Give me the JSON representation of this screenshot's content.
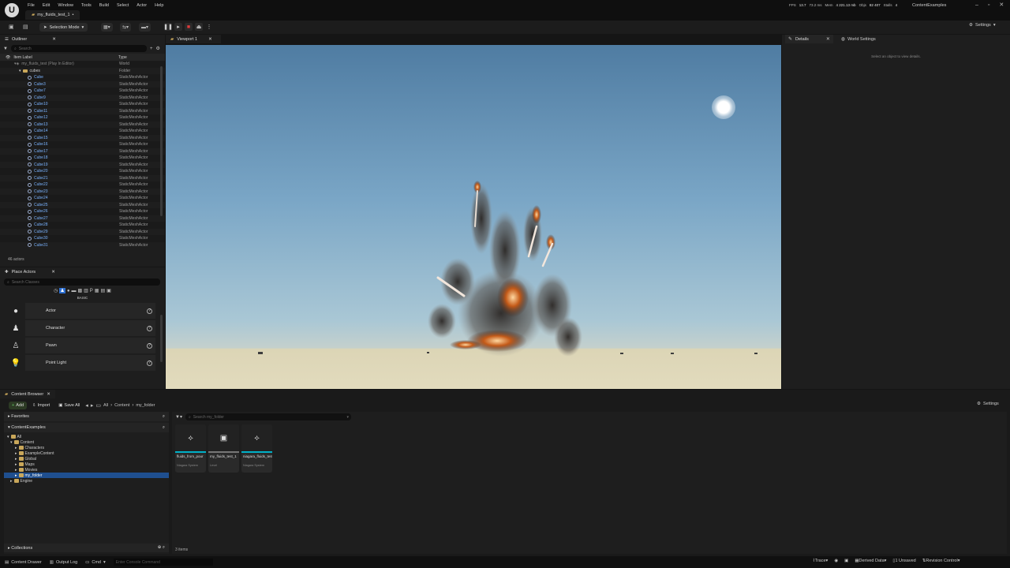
{
  "menu": [
    "File",
    "Edit",
    "Window",
    "Tools",
    "Build",
    "Select",
    "Actor",
    "Help"
  ],
  "doc_tab": "my_fluids_test_1",
  "stats": {
    "fps_label": "FPS",
    "fps": "13.7",
    "ms": "73.2 ms",
    "mem_label": "Mem",
    "mem": "4 221.13 mb",
    "objs_label": "Objs",
    "objs": "82 407",
    "stalls_label": "Stalls",
    "stalls": "4"
  },
  "project": "ContentExamples",
  "toolbar": {
    "mode": "Selection Mode",
    "settings": "Settings"
  },
  "outliner": {
    "tab": "Outliner",
    "search_placeholder": "Search",
    "col_label": "Item Label",
    "col_type": "Type",
    "world": {
      "label": "my_fluids_test (Play In Editor)",
      "type": "World"
    },
    "folder": {
      "label": "cubes",
      "type": "Folder"
    },
    "rows": [
      "Cube",
      "Cube3",
      "Cube7",
      "Cube9",
      "Cube10",
      "Cube11",
      "Cube12",
      "Cube13",
      "Cube14",
      "Cube15",
      "Cube16",
      "Cube17",
      "Cube18",
      "Cube19",
      "Cube20",
      "Cube21",
      "Cube22",
      "Cube23",
      "Cube24",
      "Cube25",
      "Cube26",
      "Cube27",
      "Cube28",
      "Cube29",
      "Cube30",
      "Cube31"
    ],
    "row_type": "StaticMeshActor",
    "count": "46 actors"
  },
  "place": {
    "tab": "Place Actors",
    "search_placeholder": "Search Classes",
    "category": "BASIC",
    "items": [
      {
        "label": "Actor",
        "icon": "sphere-icon"
      },
      {
        "label": "Character",
        "icon": "character-icon"
      },
      {
        "label": "Pawn",
        "icon": "pawn-icon"
      },
      {
        "label": "Point Light",
        "icon": "bulb-icon"
      }
    ]
  },
  "viewport": {
    "tab": "Viewport 1"
  },
  "details": {
    "tab": "Details",
    "tab2": "World Settings",
    "empty": "Select an object to view details."
  },
  "content_browser": {
    "tab": "Content Browser",
    "add": "Add",
    "import": "Import",
    "save_all": "Save All",
    "breadcrumb": [
      "All",
      "Content",
      "my_folder"
    ],
    "settings": "Settings",
    "search_placeholder": "Search my_folder",
    "favorites": "Favorites",
    "root": "ContentExamples",
    "tree": [
      "All",
      "Content",
      "Characters",
      "ExampleContent",
      "Global",
      "Maps",
      "Movies",
      "my_folder",
      "Engine"
    ],
    "collections": "Collections",
    "items_count": "3 items",
    "assets": [
      {
        "name": "fluids_from_pour",
        "type": "Niagara System",
        "icon": "niagara-icon"
      },
      {
        "name": "my_fluids_test_1",
        "type": "Level",
        "icon": "level-icon"
      },
      {
        "name": "niagara_fluids_test",
        "type": "Niagara System",
        "icon": "niagara-icon"
      }
    ]
  },
  "status": {
    "drawer": "Content Drawer",
    "output": "Output Log",
    "cmd": "Cmd",
    "console_placeholder": "Enter Console Command",
    "trace": "Trace",
    "ddc": "Derived Data",
    "unsaved": "1 Unsaved",
    "rc": "Revision Control"
  },
  "colors": {
    "accent": "#00b0c8",
    "folder": "#c9a75a",
    "selected": "#1f4f8f",
    "stop": "#e03a3a"
  }
}
